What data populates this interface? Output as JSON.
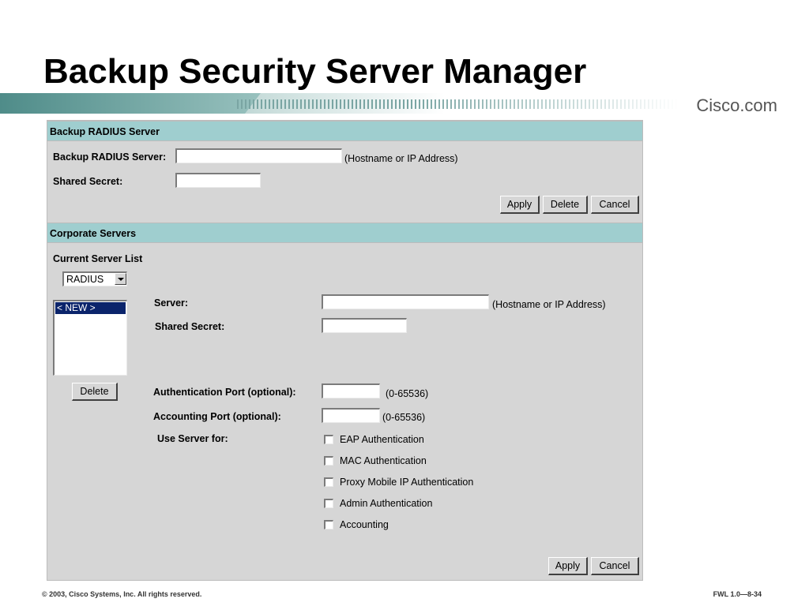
{
  "slide": {
    "title": "Backup Security Server Manager",
    "logo": "Cisco.com",
    "footer_left": "© 2003, Cisco Systems, Inc. All rights reserved.",
    "footer_right": "FWL 1.0—8-34"
  },
  "backup_section": {
    "header": "Backup RADIUS Server",
    "server_label": "Backup RADIUS Server:",
    "server_value": "",
    "server_hint": "(Hostname or IP Address)",
    "secret_label": "Shared Secret:",
    "secret_value": "",
    "apply_label": "Apply",
    "delete_label": "Delete",
    "cancel_label": "Cancel"
  },
  "corporate_section": {
    "header": "Corporate Servers",
    "list_label": "Current Server List",
    "server_type": "RADIUS",
    "server_list": [
      "< NEW >"
    ],
    "delete_label": "Delete",
    "server_label": "Server:",
    "server_value": "",
    "server_hint": "(Hostname or IP Address)",
    "secret_label": "Shared Secret:",
    "secret_value": "",
    "auth_port_label": "Authentication Port (optional):",
    "auth_port_value": "",
    "auth_port_hint": "(0-65536)",
    "acct_port_label": "Accounting Port (optional):",
    "acct_port_value": "",
    "acct_port_hint": "(0-65536)",
    "use_for_label": "Use Server for:",
    "use_for_options": [
      {
        "label": "EAP Authentication",
        "checked": false
      },
      {
        "label": "MAC Authentication",
        "checked": false
      },
      {
        "label": "Proxy Mobile IP Authentication",
        "checked": false
      },
      {
        "label": "Admin Authentication",
        "checked": false
      },
      {
        "label": "Accounting",
        "checked": false
      }
    ],
    "apply_label": "Apply",
    "cancel_label": "Cancel"
  }
}
